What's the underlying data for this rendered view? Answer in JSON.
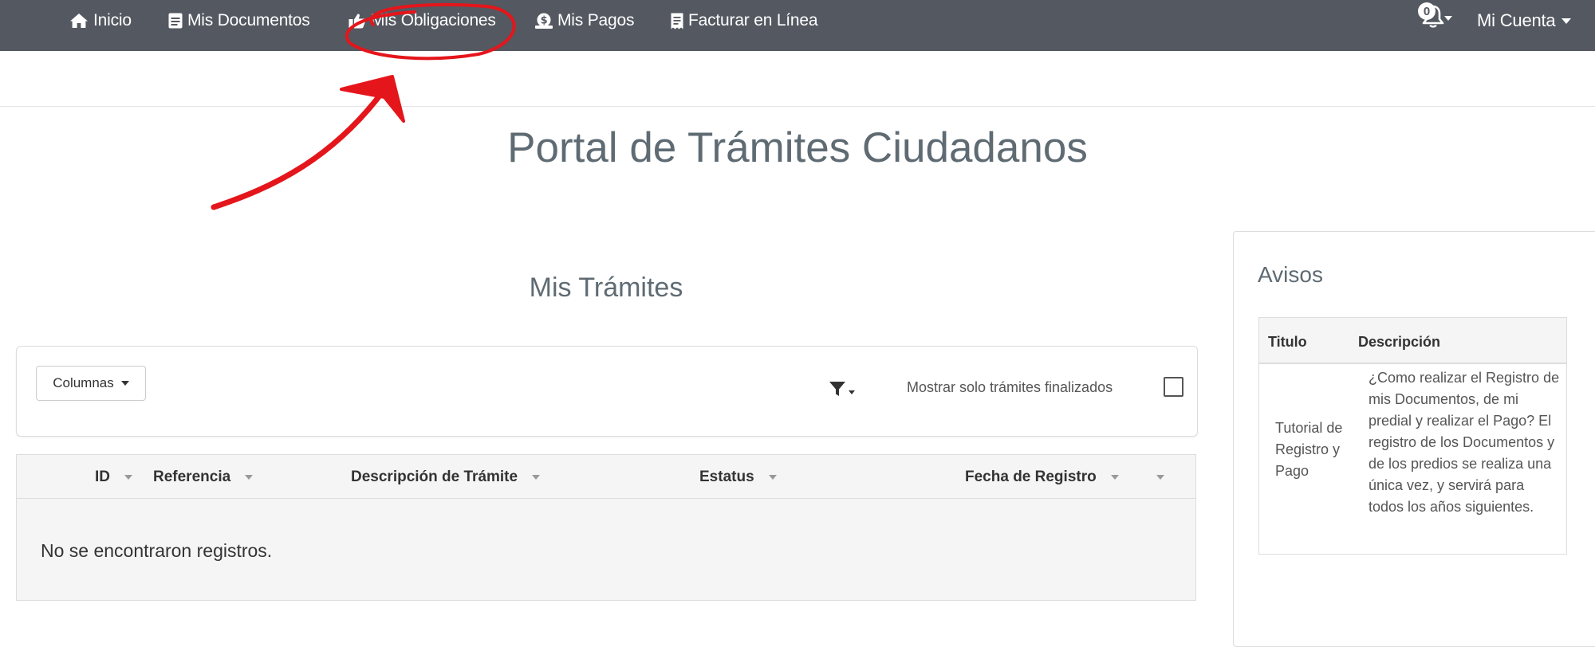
{
  "navbar": {
    "items": [
      {
        "label": "Inicio",
        "icon": "home-icon"
      },
      {
        "label": "Mis Documentos",
        "icon": "document-icon"
      },
      {
        "label": "Mis Obligaciones",
        "icon": "thumbs-up-icon"
      },
      {
        "label": "Mis Pagos",
        "icon": "money-icon"
      },
      {
        "label": "Facturar en Línea",
        "icon": "invoice-icon"
      }
    ],
    "notifications_count": "0",
    "account_label": "Mi Cuenta"
  },
  "page": {
    "title": "Portal de Trámites Ciudadanos"
  },
  "tramites": {
    "title": "Mis Trámites",
    "columns_button": "Columnas",
    "filter_icon": "filter-icon",
    "only_finished_label": "Mostrar solo trámites finalizados",
    "only_finished_checked": false,
    "table_headers": [
      "ID",
      "Referencia",
      "Descripción de Trámite",
      "Estatus",
      "Fecha de Registro"
    ],
    "empty_message": "No se encontraron registros."
  },
  "avisos": {
    "title": "Avisos",
    "headers": [
      "Titulo",
      "Descripción"
    ],
    "rows": [
      {
        "titulo": "Tutorial de Registro y Pago",
        "descripcion": "¿Como realizar el Registro de mis Documentos, de mi predial y realizar el Pago? El registro de los Documentos y de los predios se realiza una única vez, y servirá para todos los años siguientes."
      }
    ]
  },
  "colors": {
    "navbar_bg": "#545861",
    "annotation_red": "#e4161b",
    "heading_text": "#5f6b73"
  }
}
